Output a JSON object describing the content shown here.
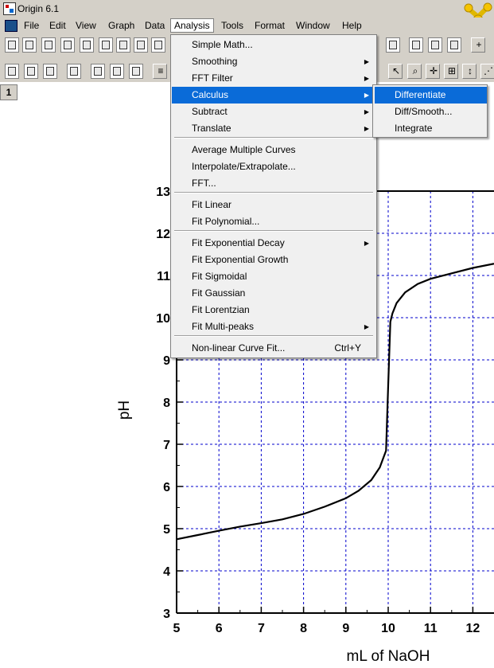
{
  "window": {
    "title": "Origin 6.1"
  },
  "menubar": [
    "File",
    "Edit",
    "View",
    "Graph",
    "Data",
    "Analysis",
    "Tools",
    "Format",
    "Window",
    "Help"
  ],
  "active_menu": "Analysis",
  "graph_window": {
    "number": "1"
  },
  "analysis_menu": [
    {
      "label": "Simple Math...",
      "submenu": false
    },
    {
      "label": "Smoothing",
      "submenu": true
    },
    {
      "label": "FFT Filter",
      "submenu": true
    },
    {
      "label": "Calculus",
      "submenu": true,
      "highlighted": true
    },
    {
      "label": "Subtract",
      "submenu": true
    },
    {
      "label": "Translate",
      "submenu": true
    },
    {
      "label": "Average Multiple Curves",
      "submenu": false
    },
    {
      "label": "Interpolate/Extrapolate...",
      "submenu": false
    },
    {
      "label": "FFT...",
      "submenu": false
    },
    {
      "label": "Fit Linear",
      "submenu": false
    },
    {
      "label": "Fit Polynomial...",
      "submenu": false
    },
    {
      "label": "Fit Exponential Decay",
      "submenu": true
    },
    {
      "label": "Fit Exponential Growth",
      "submenu": false
    },
    {
      "label": "Fit Sigmoidal",
      "submenu": false
    },
    {
      "label": "Fit Gaussian",
      "submenu": false
    },
    {
      "label": "Fit Lorentzian",
      "submenu": false
    },
    {
      "label": "Fit Multi-peaks",
      "submenu": true
    },
    {
      "label": "Non-linear Curve Fit...",
      "shortcut": "Ctrl+Y",
      "submenu": false
    }
  ],
  "calculus_submenu": [
    {
      "label": "Differentiate",
      "highlighted": true
    },
    {
      "label": "Diff/Smooth..."
    },
    {
      "label": "Integrate"
    }
  ],
  "colors": {
    "highlight": "#0a6bd8",
    "menu_bg": "#f0f0f0",
    "chrome": "#d4d0c8",
    "grid": "#0000cc"
  },
  "chart_data": {
    "type": "line",
    "xlabel": "mL of NaOH",
    "ylabel": "pH",
    "xlim": [
      5,
      12.5
    ],
    "ylim": [
      3,
      13
    ],
    "xticks": [
      5,
      6,
      7,
      8,
      9,
      10,
      11,
      12
    ],
    "yticks": [
      3,
      4,
      5,
      6,
      7,
      8,
      9,
      10,
      11,
      12,
      13
    ],
    "grid": true,
    "series": [
      {
        "x": [
          5.0,
          5.5,
          6.0,
          6.5,
          7.0,
          7.5,
          8.0,
          8.5,
          9.0,
          9.3,
          9.6,
          9.8,
          9.95,
          10.0,
          10.05,
          10.1,
          10.2,
          10.4,
          10.7,
          11.0,
          11.5,
          12.0,
          12.5
        ],
        "y": [
          4.75,
          4.85,
          4.95,
          5.05,
          5.13,
          5.22,
          5.35,
          5.52,
          5.72,
          5.9,
          6.15,
          6.45,
          6.85,
          8.4,
          9.9,
          10.1,
          10.35,
          10.6,
          10.8,
          10.92,
          11.05,
          11.18,
          11.28
        ]
      }
    ]
  }
}
